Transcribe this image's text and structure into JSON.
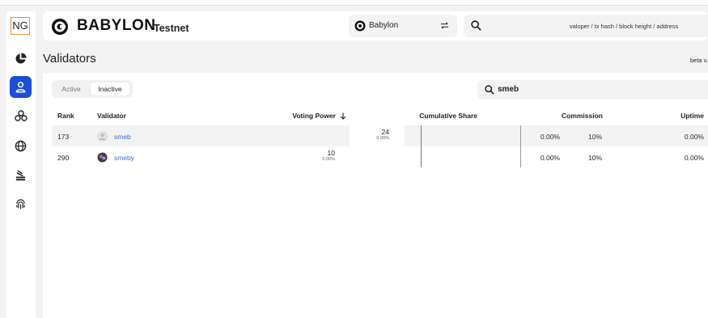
{
  "sidebar": {
    "logo_text": "NG",
    "items": [
      {
        "icon": "pie-chart-icon"
      },
      {
        "icon": "user-icon",
        "active": true
      },
      {
        "icon": "blocks-icon"
      },
      {
        "icon": "globe-icon"
      },
      {
        "icon": "stack-icon"
      },
      {
        "icon": "fingerprint-icon"
      }
    ]
  },
  "header": {
    "brand_name": "BABYLON",
    "network": "Testnet",
    "chain_name": "Babylon",
    "search_placeholder": "valoper / tx hash / block height / address"
  },
  "page": {
    "title": "Validators",
    "beta_label": "beta v..."
  },
  "tabs": [
    {
      "label": "Active",
      "selected": false
    },
    {
      "label": "Inactive",
      "selected": true
    }
  ],
  "filter": {
    "value": "smeb"
  },
  "table": {
    "headers": {
      "rank": "Rank",
      "validator": "Validator",
      "voting_power": "Voting Power",
      "cumulative_share": "Cumulative Share",
      "commission": "Commission",
      "uptime": "Uptime"
    },
    "rows": [
      {
        "rank": "173",
        "name": "smeb",
        "voting_power": "24",
        "voting_pct": "0.00%",
        "cumulative": "0.00%",
        "commission": "10%",
        "uptime": "0.00%"
      },
      {
        "rank": "290",
        "name": "smeby",
        "voting_power": "10",
        "voting_pct": "0.00%",
        "cumulative": "0.00%",
        "commission": "10%",
        "uptime": "0.00%"
      }
    ]
  },
  "colors": {
    "accent": "#1d4ed8",
    "link": "#3b6fd4",
    "ng_border": "#e8913a"
  }
}
